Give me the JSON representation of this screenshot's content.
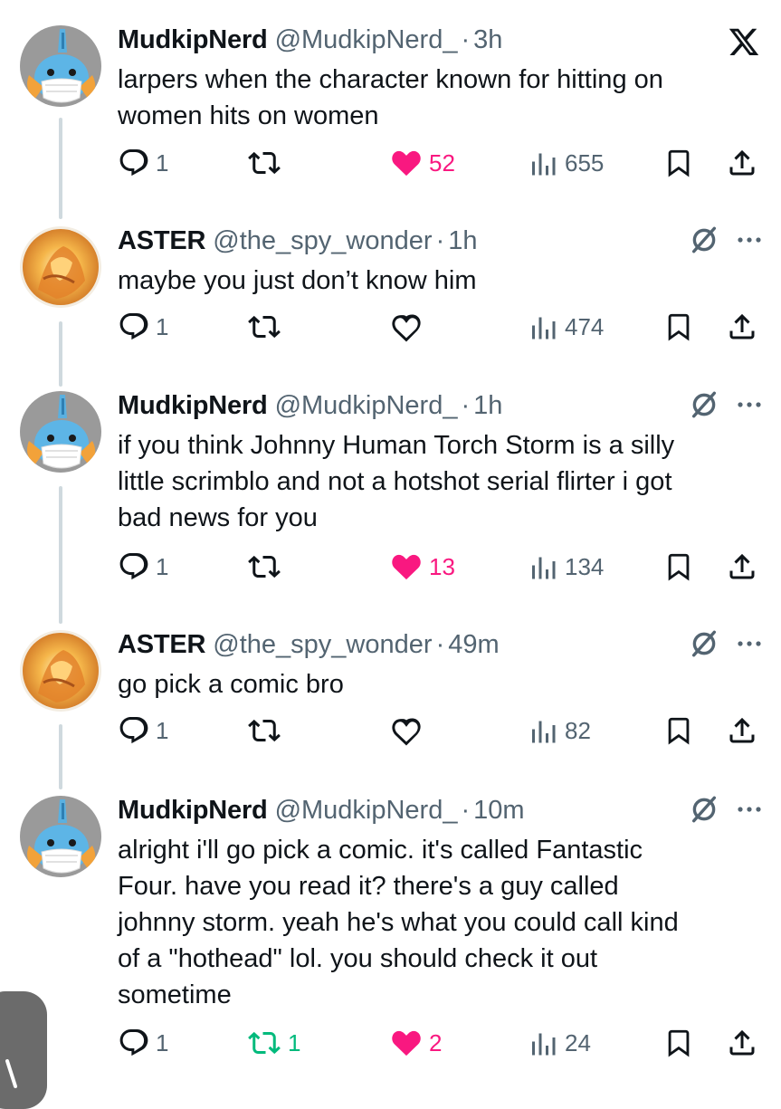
{
  "colors": {
    "text": "#0f1419",
    "secondary": "#536471",
    "like": "#f91880",
    "retweet": "#00ba7c",
    "thread_line": "#cfd9de"
  },
  "app": {
    "logo_icon": "x-logo-icon"
  },
  "tweets": [
    {
      "name": "MudkipNerd",
      "handle": "@MudkipNerd_",
      "dot": "·",
      "time": "3h",
      "avatar": "mudkip-avatar",
      "text": "larpers when the character known for hitting on\nwomen hits on women",
      "replies": "1",
      "retweets": "",
      "likes": "52",
      "liked": true,
      "retweeted": false,
      "views": "655"
    },
    {
      "name": "ASTER",
      "handle": "@the_spy_wonder",
      "dot": "·",
      "time": "1h",
      "avatar": "human-torch-avatar",
      "text": "maybe you just don’t know him",
      "replies": "1",
      "retweets": "",
      "likes": "",
      "liked": false,
      "retweeted": false,
      "views": "474"
    },
    {
      "name": "MudkipNerd",
      "handle": "@MudkipNerd_",
      "dot": "·",
      "time": "1h",
      "avatar": "mudkip-avatar",
      "text": "if you think Johnny Human Torch Storm is a silly\nlittle scrimblo and not a hotshot serial flirter i got\nbad news for you",
      "replies": "1",
      "retweets": "",
      "likes": "13",
      "liked": true,
      "retweeted": false,
      "views": "134"
    },
    {
      "name": "ASTER",
      "handle": "@the_spy_wonder",
      "dot": "·",
      "time": "49m",
      "avatar": "human-torch-avatar",
      "text": "go pick a comic bro",
      "replies": "1",
      "retweets": "",
      "likes": "",
      "liked": false,
      "retweeted": false,
      "views": "82"
    },
    {
      "name": "MudkipNerd",
      "handle": "@MudkipNerd_",
      "dot": "·",
      "time": "10m",
      "avatar": "mudkip-avatar",
      "text": "alright i'll go pick a comic. it's called Fantastic\nFour. have you read it? there's a guy called\njohnny storm. yeah he's what you could call kind\nof a \"hothead\" lol. you should check it out\nsometime",
      "replies": "1",
      "retweets": "1",
      "likes": "2",
      "liked": true,
      "retweeted": true,
      "views": "24"
    }
  ]
}
